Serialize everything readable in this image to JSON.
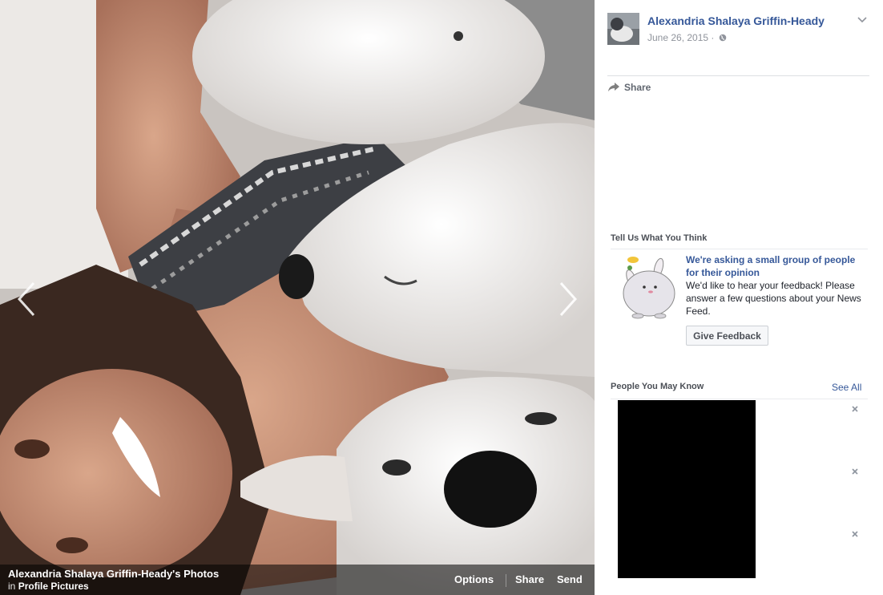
{
  "stage": {
    "album_title": "Alexandria Shalaya Griffin-Heady's Photos",
    "album_prefix": "in",
    "album_name": "Profile Pictures",
    "actions": {
      "options": "Options",
      "share": "Share",
      "send": "Send"
    }
  },
  "post": {
    "author": "Alexandria Shalaya Griffin-Heady",
    "date": "June 26, 2015 ·",
    "share_label": "Share"
  },
  "feedback": {
    "section_title": "Tell Us What You Think",
    "headline": "We're asking a small group of people for their opinion",
    "body": "We'd like to hear your feedback! Please answer a few questions about your News Feed.",
    "button_label": "Give Feedback"
  },
  "pymk": {
    "section_title": "People You May Know",
    "see_all": "See All"
  },
  "icons": [
    "chevron-left-icon",
    "chevron-right-icon",
    "globe-icon",
    "chevron-down-icon",
    "share-arrow-icon",
    "close-icon"
  ],
  "colors": {
    "link": "#365899",
    "muted": "#90949c",
    "stage_bar": "#000000"
  }
}
